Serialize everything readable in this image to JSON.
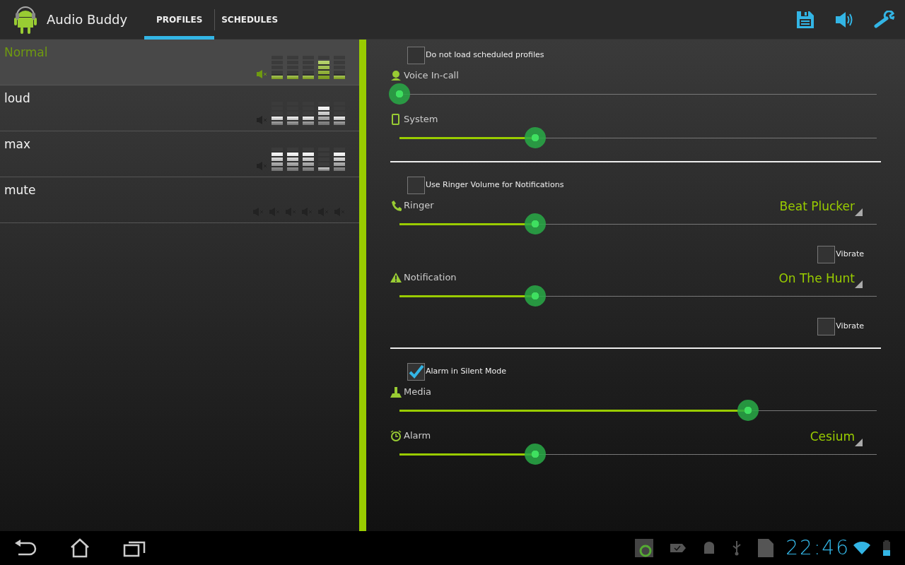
{
  "app_bar": {
    "title": "Audio Buddy",
    "tabs": [
      {
        "label": "PROFILES",
        "selected": true
      },
      {
        "label": "SCHEDULES",
        "selected": false
      }
    ]
  },
  "profiles": [
    {
      "name": "Normal",
      "selected": true,
      "muted": false,
      "bars": [
        {
          "level": 0.2
        },
        {
          "level": 0.2
        },
        {
          "level": 0.2
        },
        {
          "level": 0.8
        },
        {
          "level": 0.2
        }
      ]
    },
    {
      "name": "loud",
      "selected": false,
      "muted": false,
      "bars": [
        {
          "level": 0.4
        },
        {
          "level": 0.4
        },
        {
          "level": 0.4
        },
        {
          "level": 0.8
        },
        {
          "level": 0.4
        }
      ]
    },
    {
      "name": "max",
      "selected": false,
      "muted": false,
      "bars": [
        {
          "level": 0.8
        },
        {
          "level": 0.8
        },
        {
          "level": 0.8
        },
        {
          "level": 0.2
        },
        {
          "level": 0.8
        }
      ]
    },
    {
      "name": "mute",
      "selected": false,
      "muted": true
    }
  ],
  "settings": [
    {
      "items": [
        {
          "kind": "checkbox",
          "label": "Do not load scheduled profiles",
          "checked": false
        },
        {
          "kind": "slider",
          "label": "Voice In-call",
          "level": 0
        },
        {
          "kind": "slider",
          "label": "System",
          "level": 0.284
        }
      ]
    },
    {
      "items": [
        {
          "kind": "checkbox",
          "label": "Use Ringer Volume for Notifications",
          "checked": false
        },
        {
          "kind": "slider",
          "label": "Ringer",
          "tone": "Beat Plucker",
          "level": 0.284
        },
        {
          "kind": "vibrate",
          "label": "Vibrate",
          "checked": false
        },
        {
          "kind": "slider",
          "label": "Notification",
          "tone": "On The Hunt",
          "level": 0.284
        },
        {
          "kind": "vibrate",
          "label": "Vibrate",
          "checked": false
        }
      ]
    },
    {
      "items": [
        {
          "kind": "checkbox",
          "label": "Alarm in Silent Mode",
          "checked": true
        },
        {
          "kind": "slider",
          "label": "Media",
          "level": 0.73
        },
        {
          "kind": "slider",
          "label": "Alarm",
          "tone": "Cesium",
          "level": 0.284
        }
      ]
    }
  ],
  "system_bar": {
    "time": "22:46"
  }
}
